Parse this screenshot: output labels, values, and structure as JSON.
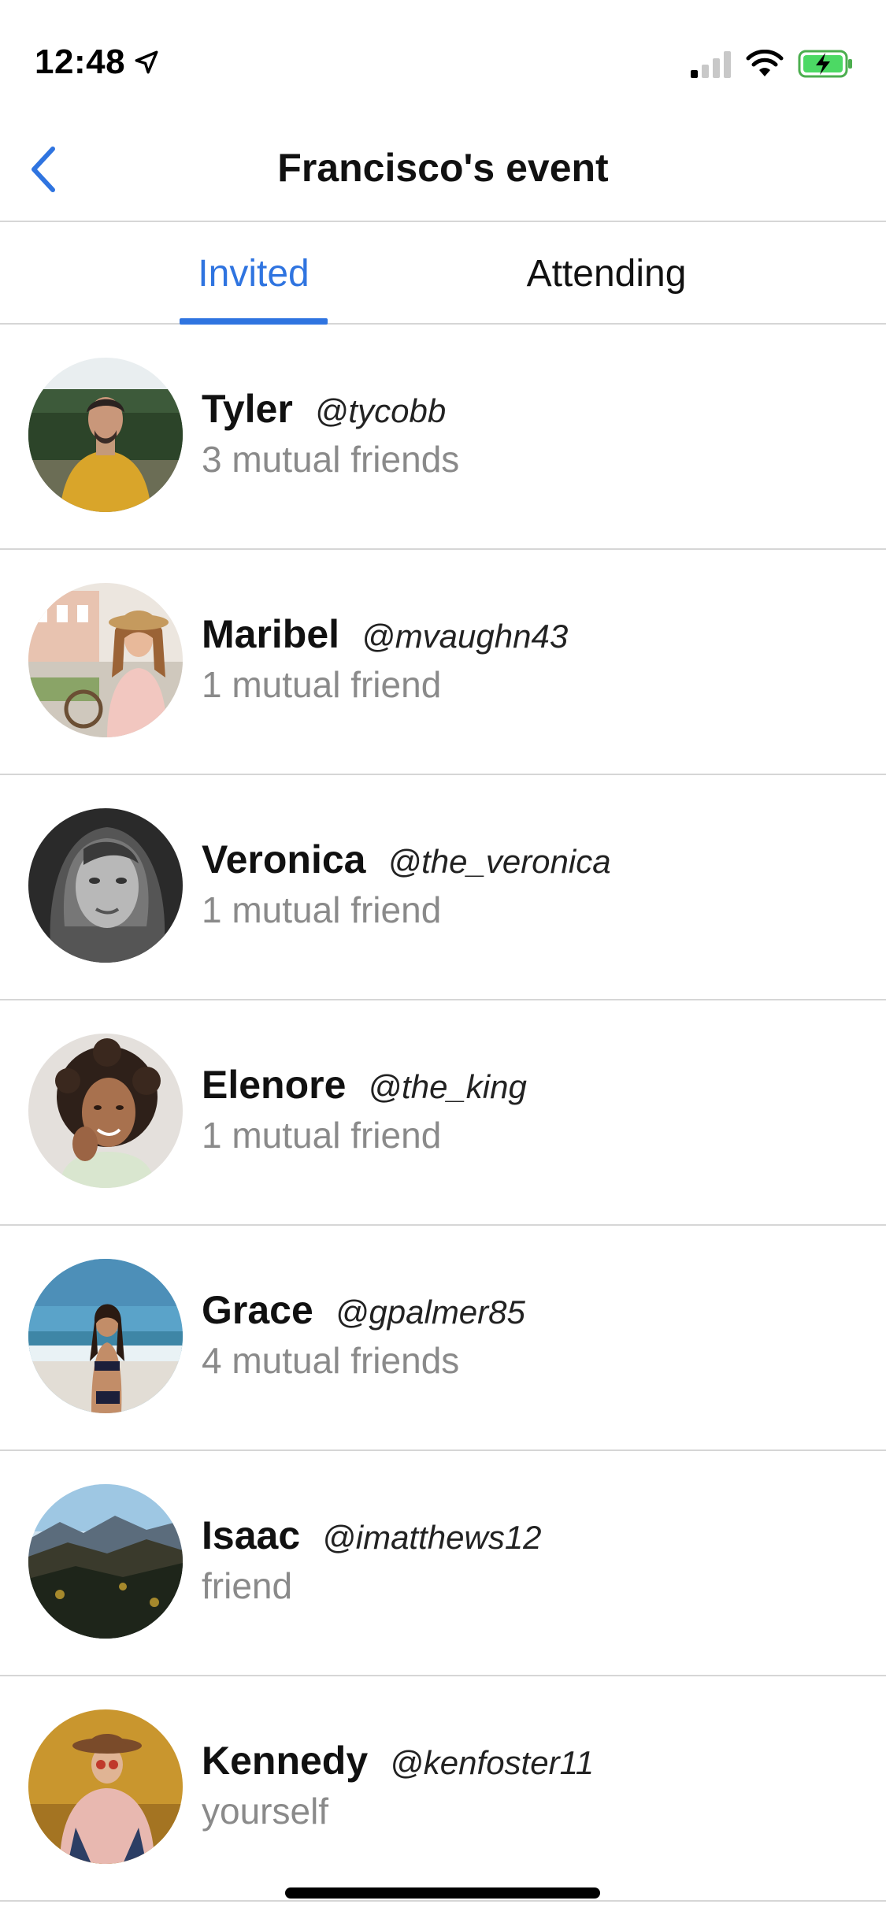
{
  "status_bar": {
    "time": "12:48"
  },
  "nav": {
    "title": "Francisco's event"
  },
  "tabs": [
    {
      "label": "Invited",
      "active": true
    },
    {
      "label": "Attending",
      "active": false
    }
  ],
  "colors": {
    "accent": "#2f74e0",
    "subtext": "#8a8a8a",
    "divider": "#d6d6d6"
  },
  "people": [
    {
      "name": "Tyler",
      "handle": "@tycobb",
      "subtitle": "3 mutual friends",
      "avatar_icon": "person-photo"
    },
    {
      "name": "Maribel",
      "handle": "@mvaughn43",
      "subtitle": "1 mutual friend",
      "avatar_icon": "person-photo"
    },
    {
      "name": "Veronica",
      "handle": "@the_veronica",
      "subtitle": "1 mutual friend",
      "avatar_icon": "person-photo"
    },
    {
      "name": "Elenore",
      "handle": "@the_king",
      "subtitle": "1 mutual friend",
      "avatar_icon": "person-photo"
    },
    {
      "name": "Grace",
      "handle": "@gpalmer85",
      "subtitle": "4 mutual friends",
      "avatar_icon": "person-photo"
    },
    {
      "name": "Isaac",
      "handle": "@imatthews12",
      "subtitle": "friend",
      "avatar_icon": "landscape-photo"
    },
    {
      "name": "Kennedy",
      "handle": "@kenfoster11",
      "subtitle": "yourself",
      "avatar_icon": "person-photo"
    }
  ]
}
